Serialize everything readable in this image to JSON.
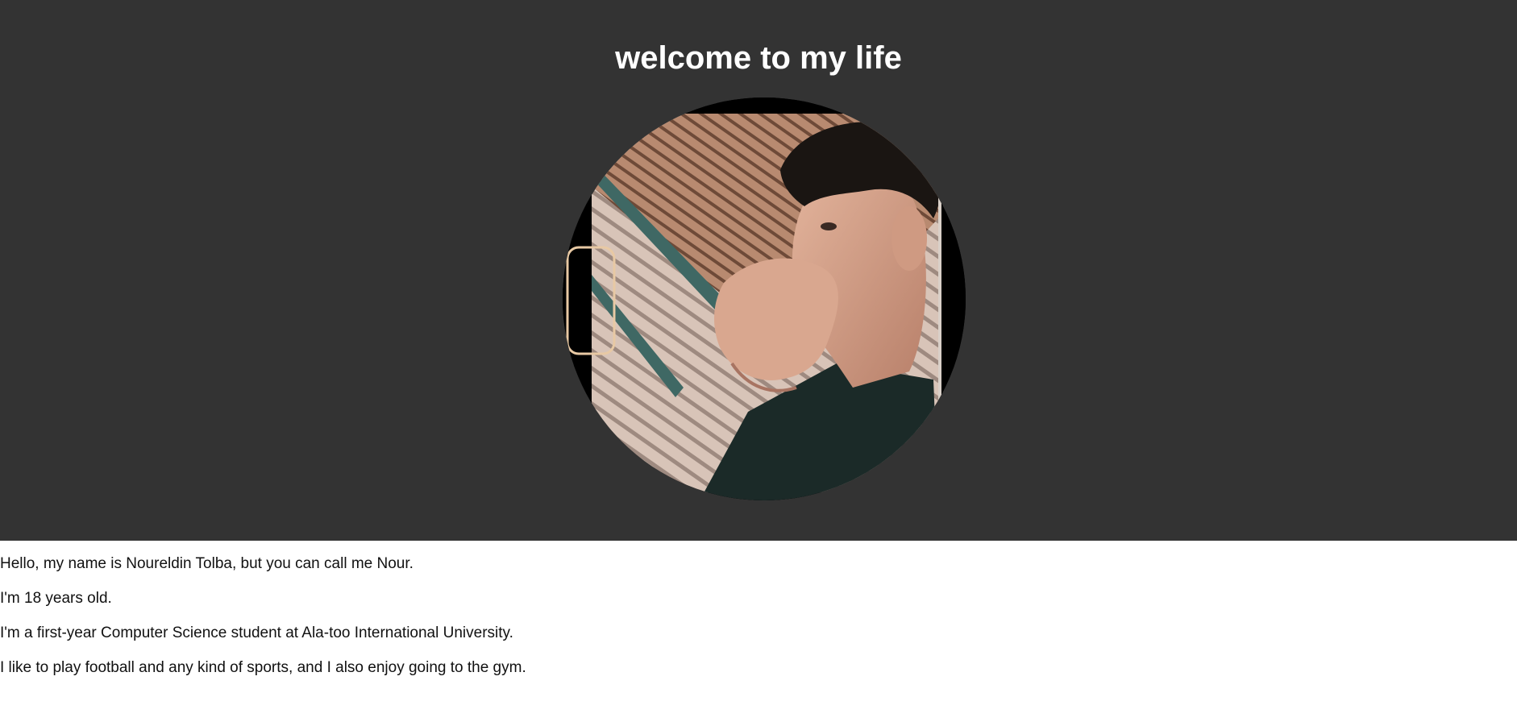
{
  "page": {
    "title": "welcome to my life",
    "header_background": "#333333",
    "title_color": "#ffffff"
  },
  "profile_photo": {
    "subject": "young man with curly dark hair, hand resting over mouth, looking to the left",
    "shape": "circle"
  },
  "bio": {
    "paragraphs": [
      "Hello, my name is Noureldin Tolba, but you can call me Nour.",
      "I'm 18 years old.",
      "I'm a first-year Computer Science student at Ala-too International University.",
      "I like to play football and any kind of sports, and I also enjoy going to the gym."
    ]
  }
}
